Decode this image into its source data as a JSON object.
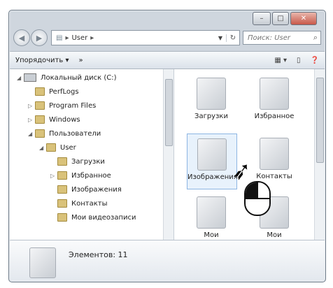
{
  "addressbar": {
    "path": "User",
    "search_placeholder": "Поиск: User"
  },
  "toolbar": {
    "organize": "Упорядочить",
    "more": "»"
  },
  "tree": {
    "items": [
      {
        "label": "Локальный диск (C:)"
      },
      {
        "label": "PerfLogs"
      },
      {
        "label": "Program Files"
      },
      {
        "label": "Windows"
      },
      {
        "label": "Пользователи"
      },
      {
        "label": "User"
      },
      {
        "label": "Загрузки"
      },
      {
        "label": "Избранное"
      },
      {
        "label": "Изображения"
      },
      {
        "label": "Контакты"
      },
      {
        "label": "Мои видеозаписи"
      }
    ]
  },
  "content": {
    "items": [
      {
        "label": "Загрузки"
      },
      {
        "label": "Избранное"
      },
      {
        "label": "Изображения"
      },
      {
        "label": "Контакты"
      },
      {
        "label": "Мои видеозаписи"
      },
      {
        "label": "Мои документы"
      }
    ]
  },
  "status": {
    "count_text": "Элементов: 11"
  },
  "colors": {
    "accent": "#8db5e3",
    "window_frame": "#cfd6de"
  }
}
